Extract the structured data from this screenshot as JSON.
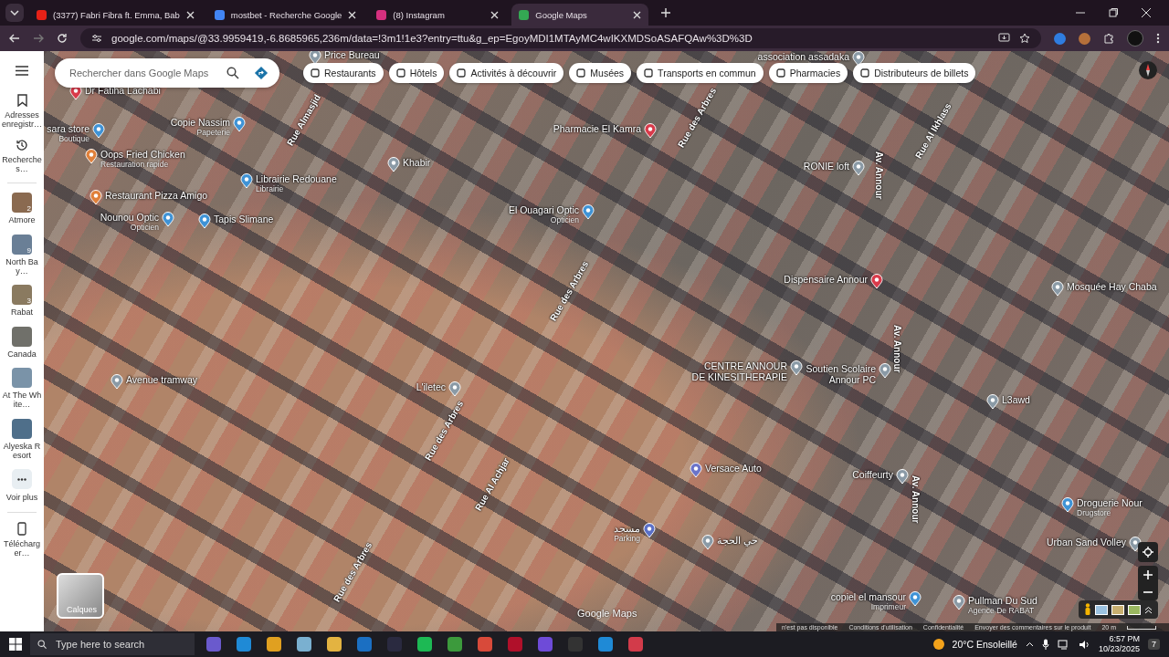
{
  "tabs": [
    {
      "title": "(3377) Fabri Fibra ft. Emma, Bab",
      "selected": false,
      "kind": "video"
    },
    {
      "title": "mostbet - Recherche Google",
      "selected": false,
      "kind": "search"
    },
    {
      "title": "(8) Instagram",
      "selected": false,
      "kind": "social"
    },
    {
      "title": "Google Maps",
      "selected": true,
      "kind": "maps"
    }
  ],
  "address_bar": {
    "url": "google.com/maps/@33.9959419,-6.8685965,236m/data=!3m1!1e3?entry=ttu&g_ep=EgoyMDI1MTAyMC4wIKXMDSoASAFQAw%3D%3D"
  },
  "sidebar": {
    "items": [
      {
        "label": "Adresses enregistr…",
        "kind": "saved"
      },
      {
        "label": "Recherches…",
        "kind": "history"
      }
    ],
    "recents": [
      {
        "label": "Atmore",
        "count": "2"
      },
      {
        "label": "North Bay…",
        "count": "9"
      },
      {
        "label": "Rabat",
        "count": "3"
      },
      {
        "label": "Canada"
      },
      {
        "label": "At The White…"
      },
      {
        "label": "Alyeska Resort"
      }
    ],
    "more": "Voir plus",
    "download": "Télécharger…"
  },
  "search": {
    "placeholder": "Rechercher dans Google Maps"
  },
  "chips": [
    "Restaurants",
    "Hôtels",
    "Activités à découvrir",
    "Musées",
    "Transports en commun",
    "Pharmacies",
    "Distributeurs de billets"
  ],
  "places": [
    {
      "name": "Price Bureau",
      "kind": "generic"
    },
    {
      "name": "association assadaka",
      "kind": "generic"
    },
    {
      "name": "Dr Fatiha Lachabi",
      "kind": "health"
    },
    {
      "name": "sara store",
      "category": "Boutique",
      "kind": "shop"
    },
    {
      "name": "Copie Nassim",
      "category": "Papeterie",
      "kind": "shop"
    },
    {
      "name": "Oops Fried Chicken",
      "category": "Restauration rapide",
      "kind": "food"
    },
    {
      "name": "Restaurant Pizza Amigo",
      "kind": "food"
    },
    {
      "name": "Nounou Optic",
      "category": "Opticien",
      "kind": "shop"
    },
    {
      "name": "Tapis Slimane",
      "kind": "shop"
    },
    {
      "name": "Librairie Redouane",
      "category": "Librairie",
      "kind": "shop"
    },
    {
      "name": "Khabir",
      "kind": "generic"
    },
    {
      "name": "Pharmacie El Kamra",
      "kind": "health"
    },
    {
      "name": "El Ouagari Optic",
      "category": "Opticien",
      "kind": "shop"
    },
    {
      "name": "RONIE loft",
      "kind": "generic"
    },
    {
      "name": "Dispensaire Annour",
      "kind": "health"
    },
    {
      "name": "Avenue tramway",
      "kind": "generic"
    },
    {
      "name": "L'iletec",
      "kind": "generic"
    },
    {
      "name": "CENTRE ANNOUR DE KINESITHERAPIE",
      "kind": "generic"
    },
    {
      "name": "Soutien Scolaire Annour PC",
      "kind": "generic"
    },
    {
      "name": "Versace Auto",
      "kind": "auto"
    },
    {
      "name": "Coiffeurty",
      "kind": "generic"
    },
    {
      "name": "L3awd",
      "kind": "generic"
    },
    {
      "name": "Mosquée Hay Chaba",
      "kind": "generic"
    },
    {
      "name": "Droguerie Nour",
      "category": "Drugstore",
      "kind": "shop"
    },
    {
      "name": "حي الحجة",
      "kind": "generic"
    },
    {
      "name": "Urban Sand Volley",
      "kind": "generic"
    },
    {
      "name": "مسجد",
      "category": "Parking",
      "kind": "parking"
    },
    {
      "name": "copiel el mansour",
      "category": "Imprimeur",
      "kind": "shop"
    },
    {
      "name": "Pullman Du Sud",
      "category": "Agence De RABAT",
      "kind": "generic"
    }
  ],
  "streets": [
    "Rue Almasjid",
    "Rue des Arbres",
    "Rue Al Ikhlass",
    "Av. Annour",
    "Rue des Arbres",
    "Av. Annour",
    "Rue des Arbres",
    "Rue Al Achjar",
    "Av. Annour",
    "Rue des Arbres"
  ],
  "layers_button": "Calques",
  "map_logo": "Google Maps",
  "footer": [
    "n'est pas disponible",
    "Conditions d'utilisation",
    "Confidentialité",
    "Envoyer des commentaires sur le produit"
  ],
  "scale": "20 m",
  "taskbar": {
    "search_placeholder": "Type here to search",
    "weather": "20°C Ensoleillé",
    "time": "6:57 PM",
    "date": "10/23/2025",
    "notifications": "7"
  }
}
